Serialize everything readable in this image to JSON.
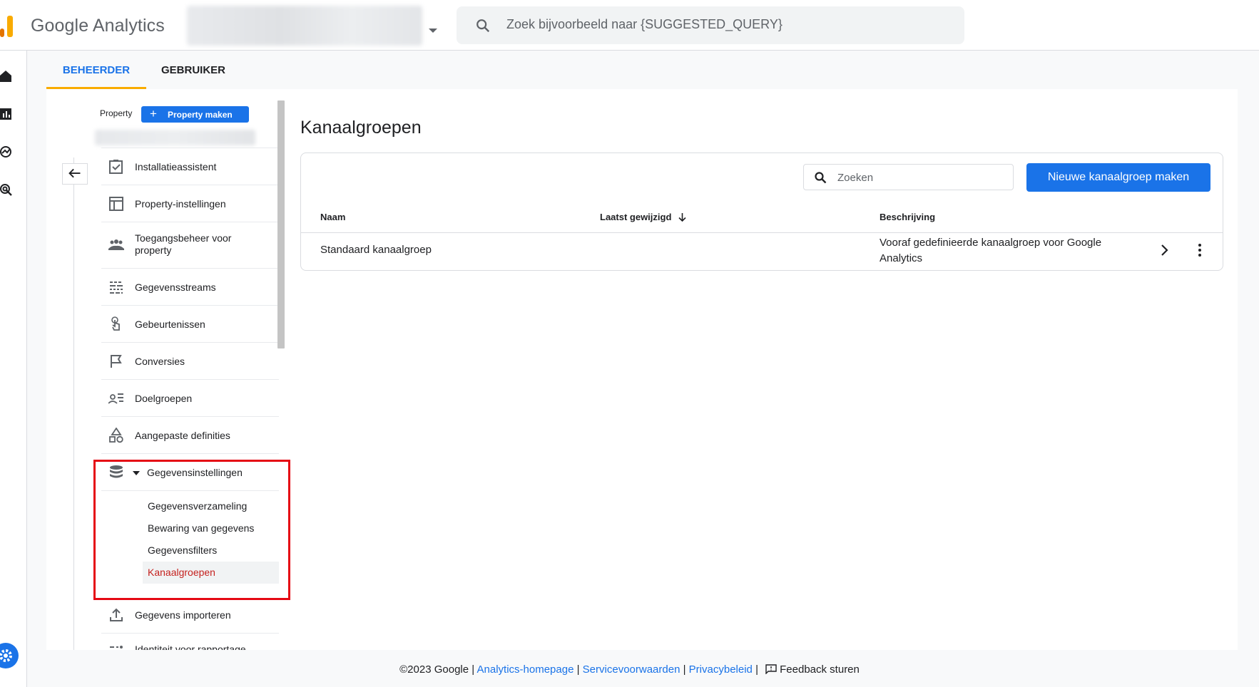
{
  "header": {
    "brand": "Google Analytics",
    "search_placeholder": "Zoek bijvoorbeeld naar {SUGGESTED_QUERY}"
  },
  "tabs": [
    {
      "label": "BEHEERDER",
      "active": true
    },
    {
      "label": "GEBRUIKER",
      "active": false
    }
  ],
  "sidebar": {
    "property_label": "Property",
    "create_property_label": "Property maken",
    "items": [
      {
        "label": "Installatieassistent",
        "icon": "checkbox-icon"
      },
      {
        "label": "Property-instellingen",
        "icon": "layout-icon"
      },
      {
        "label": "Toegangsbeheer voor property",
        "icon": "people-icon"
      },
      {
        "label": "Gegevensstreams",
        "icon": "streams-icon"
      },
      {
        "label": "Gebeurtenissen",
        "icon": "touch-icon"
      },
      {
        "label": "Conversies",
        "icon": "flag-icon"
      },
      {
        "label": "Doelgroepen",
        "icon": "audience-icon"
      },
      {
        "label": "Aangepaste definities",
        "icon": "shapes-icon"
      },
      {
        "label": "Gegevensinstellingen",
        "icon": "database-icon",
        "expanded": true
      }
    ],
    "sub_items": [
      {
        "label": "Gegevensverzameling",
        "active": false
      },
      {
        "label": "Bewaring van gegevens",
        "active": false
      },
      {
        "label": "Gegevensfilters",
        "active": false
      },
      {
        "label": "Kanaalgroepen",
        "active": true
      }
    ],
    "after_items": [
      {
        "label": "Gegevens importeren",
        "icon": "upload-icon"
      },
      {
        "label": "Identiteit voor rapportage",
        "icon": "identity-icon"
      }
    ]
  },
  "content": {
    "title": "Kanaalgroepen",
    "filter_placeholder": "Zoeken",
    "new_button_label": "Nieuwe kanaalgroep maken",
    "columns": [
      "Naam",
      "Laatst gewijzigd",
      "Beschrijving"
    ],
    "rows": [
      {
        "name": "Standaard kanaalgroep",
        "last_modified": "",
        "description_line1": "Vooraf gedefinieerde kanaalgroep voor Google",
        "description_line2": "Analytics"
      }
    ]
  },
  "footer": {
    "copyright": "©2023 Google |",
    "link_home": "Analytics-homepage",
    "sep1": "|",
    "link_terms": "Servicevoorwaarden",
    "sep2": "|",
    "link_privacy": "Privacybeleid",
    "sep3": "|",
    "feedback": "Feedback sturen"
  },
  "colors": {
    "accent": "#1a73e8",
    "tab_indicator": "#f9ab00",
    "active_subitem": "#c5221f",
    "highlight_box": "#e50914"
  }
}
